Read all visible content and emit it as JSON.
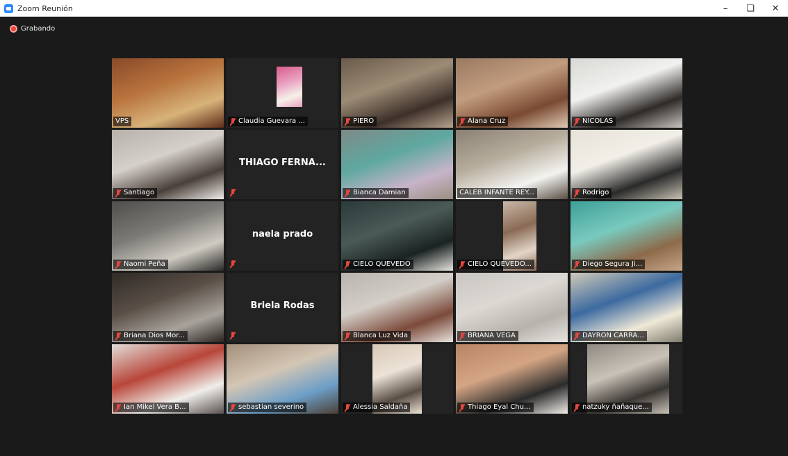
{
  "window": {
    "title": "Zoom Reunión",
    "minimize_icon": "minimize-icon",
    "maximize_icon": "restore-icon",
    "close_icon": "close-icon"
  },
  "recording": {
    "label": "Grabando",
    "color": "#e8463c"
  },
  "active_speaker_color": "#f1e35e",
  "participants": [
    {
      "name": "VPS",
      "muted": false,
      "video": true
    },
    {
      "name": "Claudia Guevara ...",
      "muted": true,
      "video": true
    },
    {
      "name": "PIERO",
      "muted": true,
      "video": true
    },
    {
      "name": "Alana Cruz",
      "muted": true,
      "video": true
    },
    {
      "name": "NICOLAS",
      "muted": true,
      "video": true
    },
    {
      "name": "Santiago",
      "muted": true,
      "video": true
    },
    {
      "name": "THIAGO FERNA...",
      "muted": true,
      "video": false
    },
    {
      "name": "Bianca Damian",
      "muted": true,
      "video": true
    },
    {
      "name": "CALEB INFANTE REY...",
      "muted": false,
      "video": true
    },
    {
      "name": "Rodrigo",
      "muted": true,
      "video": true
    },
    {
      "name": "Naomi  Peña",
      "muted": true,
      "video": true
    },
    {
      "name": "naela prado",
      "muted": true,
      "video": false
    },
    {
      "name": "CIELO QUEVEDO",
      "muted": true,
      "video": true
    },
    {
      "name": "CIELO QUEVEDO...",
      "muted": true,
      "video": true
    },
    {
      "name": "Diego Segura Ji...",
      "muted": true,
      "video": true
    },
    {
      "name": "Briana Dios Mor...",
      "muted": true,
      "video": true
    },
    {
      "name": "Briela Rodas",
      "muted": true,
      "video": false
    },
    {
      "name": "Blanca Luz Vida",
      "muted": true,
      "video": true
    },
    {
      "name": "BRIANA VEGA",
      "muted": true,
      "video": true
    },
    {
      "name": "DAYRON CARRA...",
      "muted": true,
      "video": true
    },
    {
      "name": "Ian Mikel Vera B...",
      "muted": true,
      "video": true
    },
    {
      "name": "sebastian severino",
      "muted": true,
      "video": true
    },
    {
      "name": "Alessia Saldaña",
      "muted": true,
      "video": true
    },
    {
      "name": "Thiago Eyal Chu...",
      "muted": true,
      "video": true
    },
    {
      "name": "natzuky ñañaque...",
      "muted": true,
      "video": true
    }
  ]
}
